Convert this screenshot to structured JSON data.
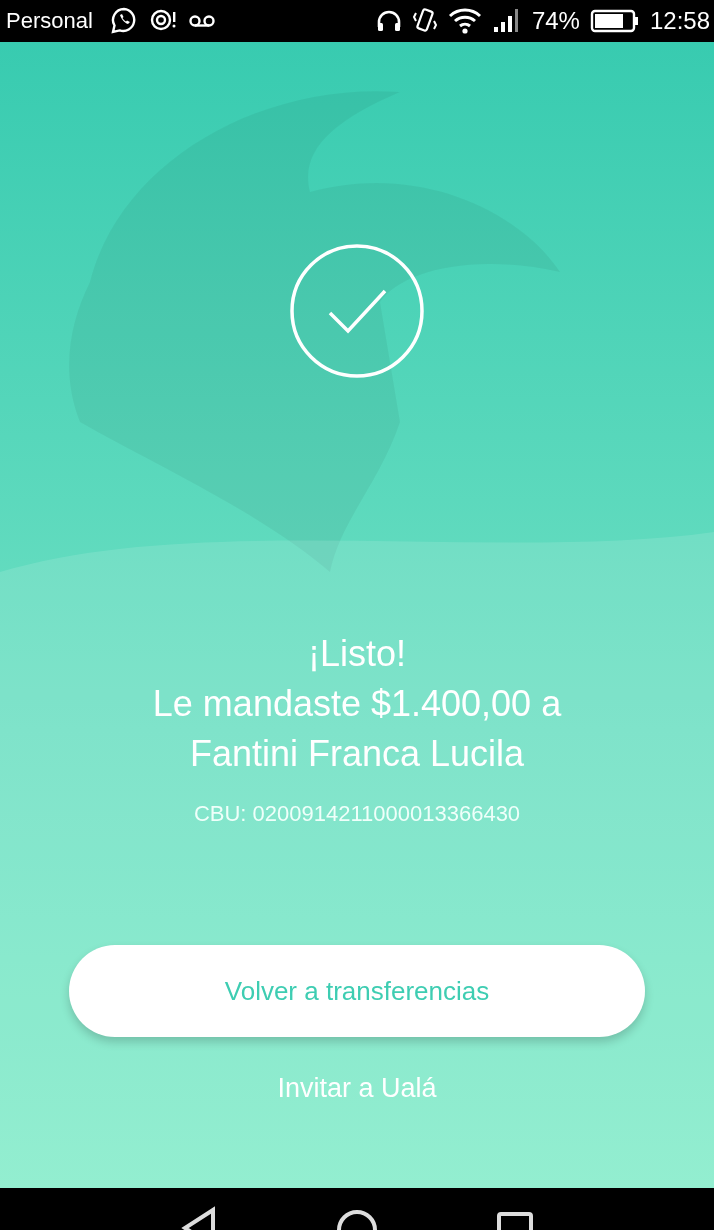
{
  "status_bar": {
    "carrier": "Personal",
    "battery_percent": "74%",
    "time": "12:58"
  },
  "confirmation": {
    "title": "¡Listo!",
    "message": "Le mandaste $1.400,00 a Fantini Franca Lucila",
    "cbu": "CBU: 0200914211000013366430"
  },
  "primary_button": {
    "label": "Volver a transferencias"
  },
  "secondary_link": {
    "label": "Invitar a Ualá"
  }
}
